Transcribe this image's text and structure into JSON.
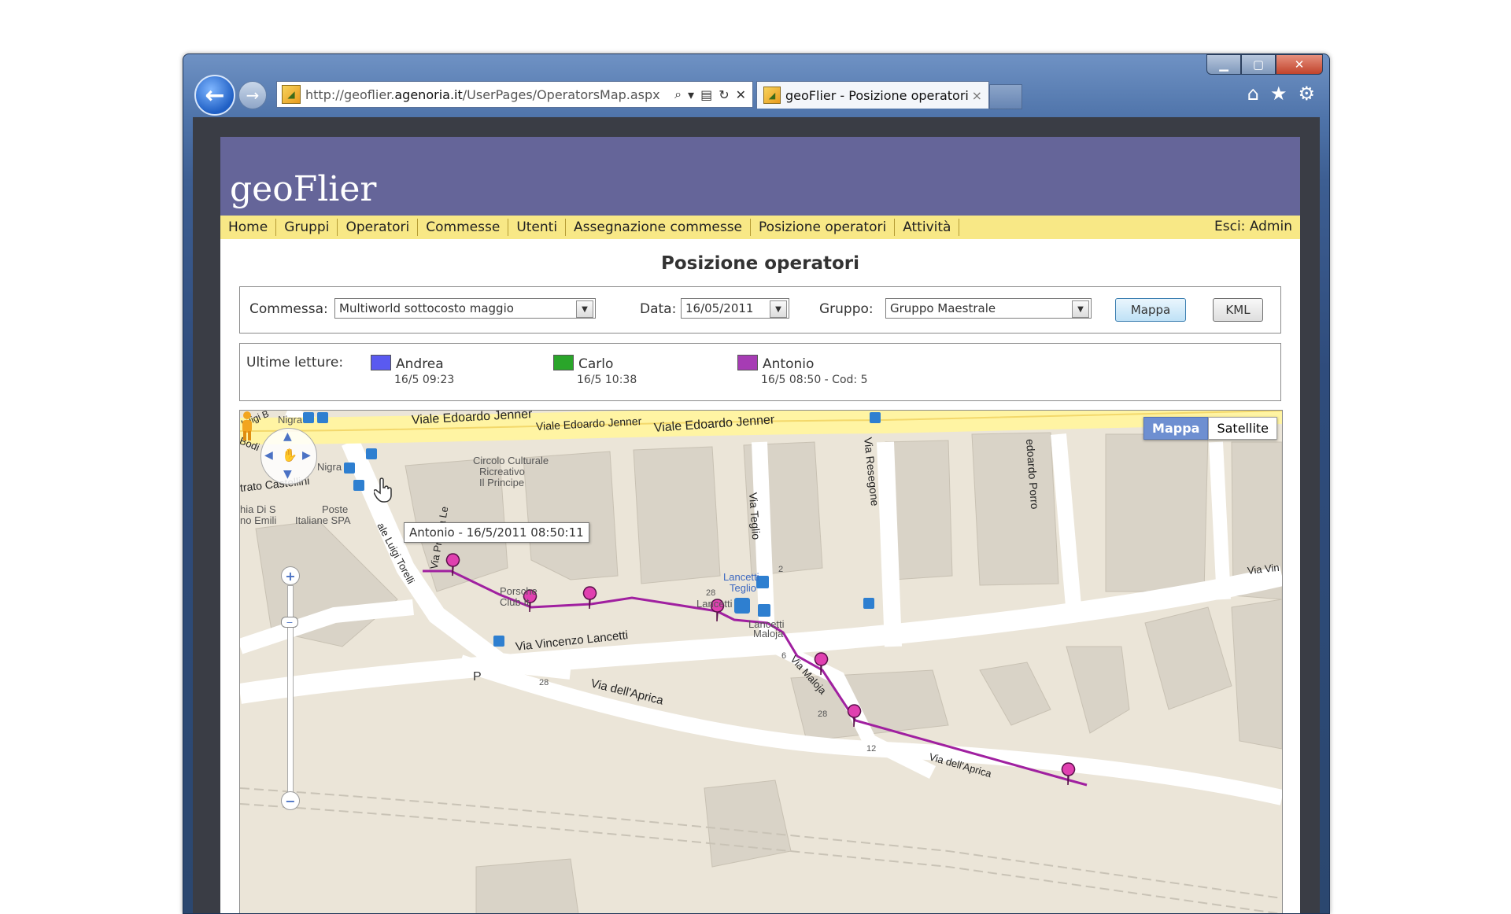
{
  "browser": {
    "url_prefix": "http://geoflier.",
    "url_domain": "agenoria.it",
    "url_path": "/UserPages/OperatorsMap.aspx",
    "tab_title": "geoFlier - Posizione operatori",
    "tab_close": "×",
    "window_buttons": {
      "minimize": "▁",
      "maximize": "▢",
      "close": "✕"
    },
    "toolbar_icons": [
      "home-icon",
      "star-icon",
      "gear-icon"
    ],
    "address_icons": [
      "search-icon",
      "dropdown-icon",
      "compat-icon",
      "refresh-icon",
      "stop-icon"
    ]
  },
  "app": {
    "logo": "geoFlier",
    "menu": [
      "Home",
      "Gruppi",
      "Operatori",
      "Commesse",
      "Utenti",
      "Assegnazione commesse",
      "Posizione operatori",
      "Attività"
    ],
    "logout": "Esci: Admin",
    "title": "Posizione operatori"
  },
  "filters": {
    "commessa_label": "Commessa:",
    "commessa_value": "Multiworld sottocosto maggio",
    "data_label": "Data:",
    "data_value": "16/05/2011",
    "gruppo_label": "Gruppo:",
    "gruppo_value": "Gruppo Maestrale",
    "btn_mappa": "Mappa",
    "btn_kml": "KML"
  },
  "legend": {
    "title": "Ultime letture:",
    "operators": [
      {
        "name": "Andrea",
        "time": "16/5 09:23",
        "color": "#5a5af0"
      },
      {
        "name": "Carlo",
        "time": "16/5 10:38",
        "color": "#2aa52a"
      },
      {
        "name": "Antonio",
        "time": "16/5 08:50 - Cod: 5",
        "color": "#a63cb4"
      }
    ]
  },
  "map": {
    "type_map": "Mappa",
    "type_satellite": "Satellite",
    "tooltip": "Antonio - 16/5/2011 08:50:11",
    "route_color": "#a020a0",
    "streets": {
      "jenner1": "Viale Edoardo Jenner",
      "jenner2": "Viale Edoardo Jenner",
      "jenner3": "Viale Edoardo Jenner",
      "resegone": "Via Resegone",
      "teglio": "Via Teglio",
      "porro": "edoardo Porro",
      "castellini": "trato Castellini",
      "lancetti": "Via Vincenzo Lancetti",
      "aprica1": "Via dell'Aprica",
      "aprica2": "Via dell'Aprica",
      "maloja": "Via Maloja",
      "privata": "Via Privata Le",
      "torelli": "ale Luigi Torelli",
      "vin": "Via Vin",
      "bodi": "Bodi",
      "luigi": "Luigi B"
    },
    "pois": {
      "circolo1": "Circolo Culturale",
      "circolo2": "Ricreativo",
      "circolo3": "Il Principe",
      "poste1": "Poste",
      "poste2": "Italiane SPA",
      "nigra1": "Nigra",
      "nigra2": "Nigra",
      "lancetti_teglio1": "Lancetti",
      "lancetti_teglio2": "Teglio",
      "lancetti": "Lancetti",
      "lancetti_maloja1": "Lancetti",
      "lancetti_maloja2": "Maloja",
      "porsche1": "Porsche",
      "porsche2": "Club It",
      "chiesa": "hia Di S",
      "emili": "no Emili",
      "parking": "P",
      "n28a": "28",
      "n28b": "28",
      "n28c": "28",
      "n12": "12",
      "n6": "6",
      "n2": "2"
    }
  }
}
